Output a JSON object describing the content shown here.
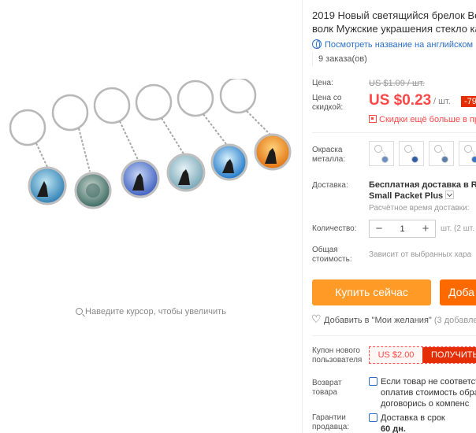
{
  "product": {
    "title_line1": "2019 Новый светящийся брелок Во",
    "title_line2": "волк Мужские украшения стекло ка",
    "translate_link": "Посмотреть название на английском",
    "orders": "9 заказа(ов)",
    "zoom_hint": "Наведите курсор, чтобы увеличить"
  },
  "price": {
    "old_label": "Цена:",
    "old_value": "US $1.09 / шт.",
    "discount_label": "Цена со скидкой:",
    "current": "US $0.23",
    "unit": "/ шт.",
    "discount_badge": "-79%",
    "promo": "Скидки ещё больше в пр"
  },
  "options": {
    "color_label": "Окраска металла:",
    "swatch_colors": [
      "#6b8fbf",
      "#2f5ea6",
      "#5c7faa",
      "#3d73c4"
    ]
  },
  "shipping": {
    "label": "Доставка:",
    "main": "Бесплатная доставка в Rus",
    "method": "Small Packet Plus",
    "time": "Расчётное время доставки:"
  },
  "quantity": {
    "label": "Количество:",
    "minus": "−",
    "value": "1",
    "plus": "+",
    "unit": "шт. (2 шт. дос"
  },
  "total": {
    "label": "Общая стоимость:",
    "value": "Зависит от выбранных хара"
  },
  "actions": {
    "buy_now": "Купить сейчас",
    "add_to_cart": "Доба",
    "wishlist": "Добавить в \"Мои желания\"",
    "wishlist_count": "(3 добавле"
  },
  "coupon": {
    "label": "Купон нового пользователя",
    "amount": "US $2.00",
    "get": "ПОЛУЧИТЬ"
  },
  "returns": {
    "label": "Возврат товара",
    "line1": "Если товар не соответств",
    "line2": "оплатив стоимость обрат",
    "line3": "договорись о компенс"
  },
  "guarantee": {
    "label": "Гарантии продавца:",
    "line1": "Доставка в срок",
    "line2": "60 дн."
  },
  "colors": {
    "accent_red": "#ff4747",
    "buy_orange": "#ff9a27",
    "cart_orange": "#ff6a00",
    "link_blue": "#2d6fc7"
  }
}
